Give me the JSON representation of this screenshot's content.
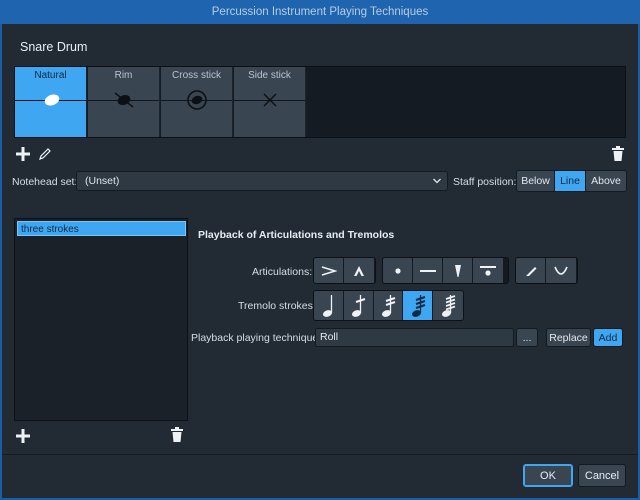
{
  "window": {
    "title": "Percussion Instrument Playing Techniques"
  },
  "instrument": {
    "name": "Snare Drum"
  },
  "techniques": [
    {
      "label": "Natural",
      "selected": true,
      "notehead": "filled-oval-notehead"
    },
    {
      "label": "Rim",
      "selected": false,
      "notehead": "x-oval-notehead"
    },
    {
      "label": "Cross stick",
      "selected": false,
      "notehead": "circled-notehead"
    },
    {
      "label": "Side stick",
      "selected": false,
      "notehead": "x-notehead"
    }
  ],
  "tile_toolbar": {
    "add_icon": "plus-icon",
    "edit_icon": "pencil-icon",
    "delete_icon": "trash-icon"
  },
  "notehead_set": {
    "label": "Notehead set:",
    "value": "(Unset)"
  },
  "staff_position": {
    "label": "Staff position:",
    "options": [
      "Below",
      "Line",
      "Above"
    ],
    "selected": "Line"
  },
  "stroke_list": {
    "items": [
      "three strokes"
    ],
    "selected": "three strokes"
  },
  "playback": {
    "title": "Playback of Articulations and Tremolos",
    "articulations_label": "Articulations:",
    "articulations_groups": [
      [
        "accent-icon",
        "marcato-icon"
      ],
      [
        "staccato-icon",
        "tenuto-icon",
        "staccatissimo-icon",
        "tenuto-staccato-icon"
      ],
      [
        "stress-icon",
        "unstress-icon"
      ]
    ],
    "tremolo_label": "Tremolo strokes:",
    "tremolo_options": [
      "no-tremolo-icon",
      "tremolo-1-stroke-icon",
      "tremolo-2-strokes-icon",
      "tremolo-3-strokes-icon",
      "tremolo-4-strokes-icon"
    ],
    "tremolo_selected": 3,
    "technique_label": "Playback playing technique:",
    "technique_value": "Roll",
    "browse_label": "...",
    "replace_label": "Replace",
    "add_label": "Add"
  },
  "dialog_buttons": {
    "ok": "OK",
    "cancel": "Cancel"
  },
  "colors": {
    "accent": "#3fa6f2",
    "background": "#222a34",
    "titlebar": "#1e64ae"
  }
}
